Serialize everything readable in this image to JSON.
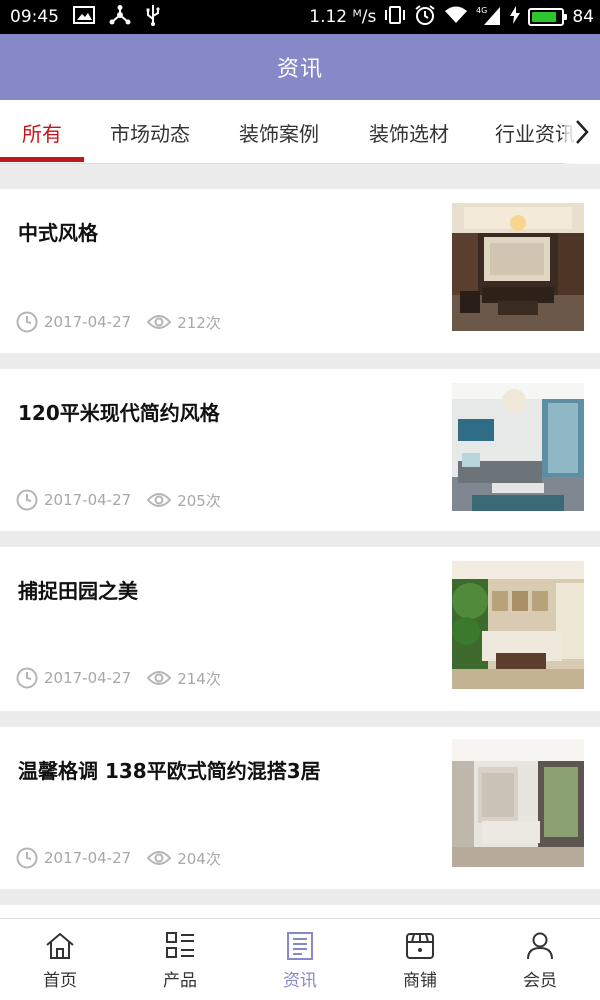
{
  "status_bar": {
    "time": "09:45",
    "speed": "1.12 ᴹ/s",
    "network": "4G",
    "battery": "84",
    "battery_level": 0.84
  },
  "header": {
    "title": "资讯"
  },
  "tabs": [
    {
      "label": "所有",
      "active": true
    },
    {
      "label": "市场动态",
      "active": false
    },
    {
      "label": "装饰案例",
      "active": false
    },
    {
      "label": "装饰选材",
      "active": false
    },
    {
      "label": "行业资讯",
      "active": false
    }
  ],
  "news": [
    {
      "title": "中式风格",
      "date": "2017-04-27",
      "views": "212次",
      "thumb": "chinese-style-living-room"
    },
    {
      "title": "120平米现代简约风格",
      "date": "2017-04-27",
      "views": "205次",
      "thumb": "modern-living-room"
    },
    {
      "title": "捕捉田园之美",
      "date": "2017-04-27",
      "views": "214次",
      "thumb": "pastoral-living-room"
    },
    {
      "title": "温馨格调 138平欧式简约混搭3居",
      "date": "2017-04-27",
      "views": "204次",
      "thumb": "european-living-room"
    }
  ],
  "bottom_nav": [
    {
      "label": "首页",
      "icon": "home-icon",
      "active": false
    },
    {
      "label": "产品",
      "icon": "grid-list-icon",
      "active": false
    },
    {
      "label": "资讯",
      "icon": "news-icon",
      "active": true
    },
    {
      "label": "商铺",
      "icon": "store-icon",
      "active": false
    },
    {
      "label": "会员",
      "icon": "user-icon",
      "active": false
    }
  ],
  "colors": {
    "header_bg": "#8788c8",
    "tab_active": "#c3161c",
    "meta_gray": "#a8a8a8"
  }
}
